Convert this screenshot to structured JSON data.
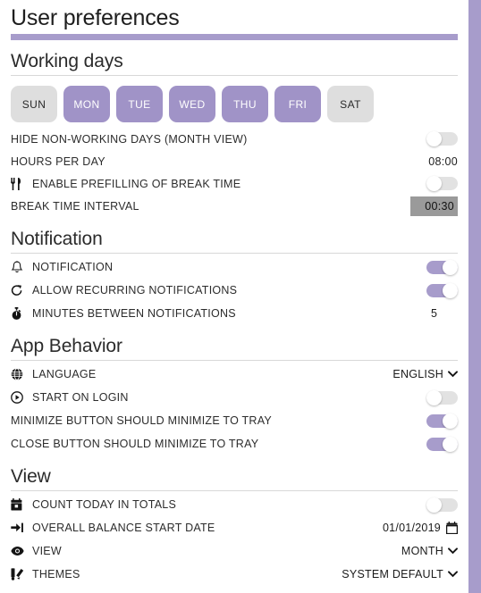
{
  "window": {
    "title": "User preferences",
    "accent_color": "#a79ccb",
    "pill_on_color": "#a093c7",
    "pill_off_color": "#dedede",
    "boxed_field_bg": "#9a9a9a"
  },
  "sections": {
    "working_days": {
      "heading": "Working days",
      "days": [
        {
          "label": "SUN",
          "enabled": false
        },
        {
          "label": "MON",
          "enabled": true
        },
        {
          "label": "TUE",
          "enabled": true
        },
        {
          "label": "WED",
          "enabled": true
        },
        {
          "label": "THU",
          "enabled": true
        },
        {
          "label": "FRI",
          "enabled": true
        },
        {
          "label": "SAT",
          "enabled": false
        }
      ],
      "rows": {
        "hide_non_working": {
          "label": "HIDE NON-WORKING DAYS (MONTH VIEW)",
          "value": "off"
        },
        "hours_per_day": {
          "label": "HOURS PER DAY",
          "value": "08:00"
        },
        "enable_prefill_break": {
          "label": "ENABLE PREFILLING OF BREAK TIME",
          "icon": "cutlery-icon",
          "value": "off"
        },
        "break_time_interval": {
          "label": "BREAK TIME INTERVAL",
          "value": "00:30"
        }
      }
    },
    "notification": {
      "heading": "Notification",
      "rows": {
        "notification": {
          "label": "NOTIFICATION",
          "icon": "bell-icon",
          "value": "on"
        },
        "allow_recurring": {
          "label": "ALLOW RECURRING NOTIFICATIONS",
          "icon": "repeat-icon",
          "value": "on"
        },
        "minutes_between": {
          "label": "MINUTES BETWEEN NOTIFICATIONS",
          "icon": "stopwatch-icon",
          "value": "5"
        }
      }
    },
    "app_behavior": {
      "heading": "App Behavior",
      "rows": {
        "language": {
          "label": "LANGUAGE",
          "icon": "globe-icon",
          "value": "ENGLISH"
        },
        "start_on_login": {
          "label": "START ON LOGIN",
          "icon": "play-circle-icon",
          "value": "off"
        },
        "minimize_to_tray": {
          "label": "MINIMIZE BUTTON SHOULD MINIMIZE TO TRAY",
          "value": "on"
        },
        "close_to_tray": {
          "label": "CLOSE BUTTON SHOULD MINIMIZE TO TRAY",
          "value": "on"
        }
      }
    },
    "view": {
      "heading": "View",
      "rows": {
        "count_today": {
          "label": "COUNT TODAY IN TOTALS",
          "icon": "calendar-icon",
          "value": "off"
        },
        "balance_start_date": {
          "label": "OVERALL BALANCE START DATE",
          "icon": "sign-in-icon",
          "value": "01/01/2019"
        },
        "view_mode": {
          "label": "VIEW",
          "icon": "eye-icon",
          "value": "MONTH"
        },
        "themes": {
          "label": "THEMES",
          "icon": "theme-icon",
          "value": "SYSTEM DEFAULT"
        }
      }
    }
  }
}
